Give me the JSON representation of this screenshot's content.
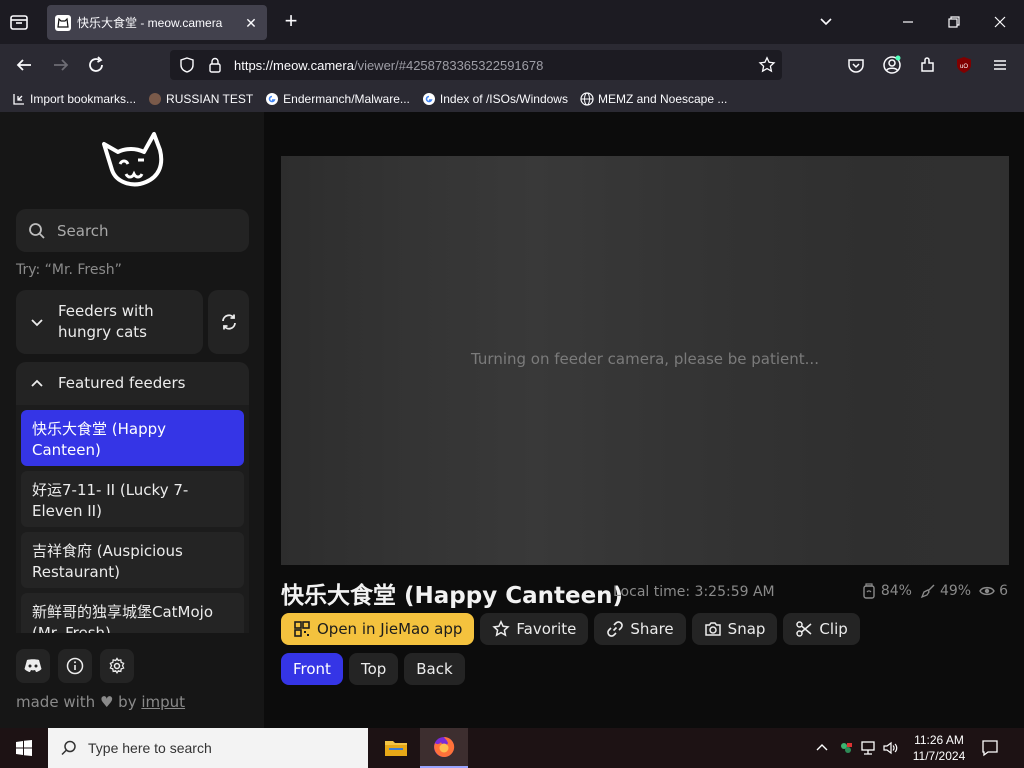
{
  "browser": {
    "tab": {
      "title": "快乐大食堂 - meow.camera",
      "close": "✕"
    },
    "new_tab": "+",
    "url_host": "https://meow.camera",
    "url_path": "/viewer/#4258783365322591678",
    "bookmarks": [
      {
        "label": "Import bookmarks..."
      },
      {
        "label": "RUSSIAN TEST"
      },
      {
        "label": "Endermanch/Malware..."
      },
      {
        "label": "Index of /ISOs/Windows"
      },
      {
        "label": "MEMZ and Noescape ..."
      }
    ],
    "colors": {
      "chrome": "#2b2a33",
      "tabbar": "#1c1b22",
      "urlbar": "#1c1b22"
    }
  },
  "sidebar": {
    "search_placeholder": "Search",
    "try_hint": "Try: “Mr. Fresh”",
    "group_hungry": "Feeders with hungry cats",
    "group_featured": "Featured feeders",
    "feeders": [
      {
        "label": "快乐大食堂 (Happy Canteen)",
        "active": true
      },
      {
        "label": "好运7-11- II  (Lucky 7-Eleven II)",
        "active": false
      },
      {
        "label": "吉祥食府 (Auspicious Restaurant)",
        "active": false
      },
      {
        "label": "新鲜哥的独享城堡CatMojo (Mr. Fresh)",
        "active": false
      }
    ],
    "credit_prefix": "made with",
    "credit_by": "by",
    "credit_link": "imput"
  },
  "viewer": {
    "loading_text": "Turning on feeder camera, please be patient...",
    "title": "快乐大食堂 (Happy Canteen)",
    "local_time": "Local time: 3:25:59 AM",
    "stats": {
      "food": "84%",
      "clean": "49%",
      "viewers": "6"
    },
    "actions": {
      "open_app": "Open in JieMao app",
      "favorite": "Favorite",
      "share": "Share",
      "snap": "Snap",
      "clip": "Clip"
    },
    "views": {
      "front": "Front",
      "top": "Top",
      "back": "Back"
    },
    "colors": {
      "accent_blue": "#3535e6",
      "accent_yellow": "#f4c23e"
    }
  },
  "taskbar": {
    "search_placeholder": "Type here to search",
    "time": "11:26 AM",
    "date": "11/7/2024"
  }
}
